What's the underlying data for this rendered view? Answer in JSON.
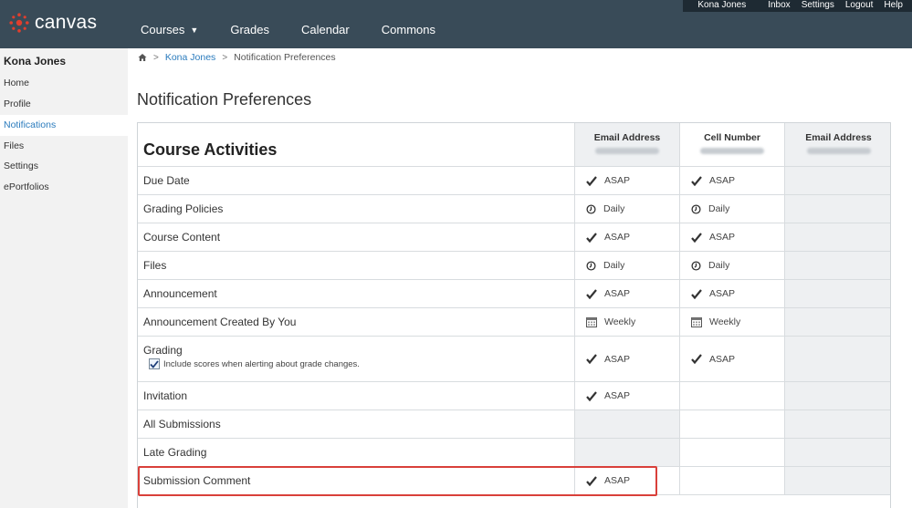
{
  "header": {
    "logo_text": "canvas",
    "nav": [
      {
        "label": "Courses"
      },
      {
        "label": "Grades"
      },
      {
        "label": "Calendar"
      },
      {
        "label": "Commons"
      }
    ],
    "user_nav": {
      "name": "Kona Jones",
      "links": [
        "Inbox",
        "Settings",
        "Logout",
        "Help"
      ]
    }
  },
  "sidebar": {
    "title": "Kona Jones",
    "items": [
      {
        "label": "Home"
      },
      {
        "label": "Profile"
      },
      {
        "label": "Notifications"
      },
      {
        "label": "Files"
      },
      {
        "label": "Settings"
      },
      {
        "label": "ePortfolios"
      }
    ],
    "active": "Notifications"
  },
  "breadcrumb": {
    "items": [
      "Kona Jones",
      "Notification Preferences"
    ]
  },
  "page_title": "Notification Preferences",
  "table": {
    "section_title": "Course Activities",
    "channels": [
      "Email Address",
      "Cell Number",
      "Email Address"
    ],
    "rows": [
      {
        "name": "Due Date",
        "values": [
          "ASAP",
          "ASAP",
          ""
        ],
        "icons": [
          "check-icon",
          "check-icon",
          ""
        ]
      },
      {
        "name": "Grading Policies",
        "values": [
          "Daily",
          "Daily",
          ""
        ],
        "icons": [
          "clock-icon",
          "clock-icon",
          ""
        ]
      },
      {
        "name": "Course Content",
        "values": [
          "ASAP",
          "ASAP",
          ""
        ],
        "icons": [
          "check-icon",
          "check-icon",
          ""
        ]
      },
      {
        "name": "Files",
        "values": [
          "Daily",
          "Daily",
          ""
        ],
        "icons": [
          "clock-icon",
          "clock-icon",
          ""
        ]
      },
      {
        "name": "Announcement",
        "values": [
          "ASAP",
          "ASAP",
          ""
        ],
        "icons": [
          "check-icon",
          "check-icon",
          ""
        ]
      },
      {
        "name": "Announcement Created By You",
        "values": [
          "Weekly",
          "Weekly",
          ""
        ],
        "icons": [
          "calendar-icon",
          "calendar-icon",
          ""
        ]
      },
      {
        "name": "Grading",
        "values": [
          "ASAP",
          "ASAP",
          ""
        ],
        "icons": [
          "check-icon",
          "check-icon",
          ""
        ],
        "option": "Include scores when alerting about grade changes.",
        "option_checked": true
      },
      {
        "name": "Invitation",
        "values": [
          "ASAP",
          "",
          ""
        ],
        "icons": [
          "check-icon",
          "",
          ""
        ]
      },
      {
        "name": "All Submissions",
        "values": [
          "",
          "",
          ""
        ],
        "icons": [
          "",
          "",
          ""
        ]
      },
      {
        "name": "Late Grading",
        "values": [
          "",
          "",
          ""
        ],
        "icons": [
          "",
          "",
          ""
        ]
      },
      {
        "name": "Submission Comment",
        "values": [
          "ASAP",
          "",
          ""
        ],
        "icons": [
          "check-icon",
          "",
          ""
        ]
      }
    ]
  },
  "colors": {
    "header_bg": "#394b58",
    "user_nav_bg": "#1e2a33",
    "link": "#2a7bbd",
    "highlight_border": "#d9403a",
    "logo_red": "#e03e2d"
  }
}
